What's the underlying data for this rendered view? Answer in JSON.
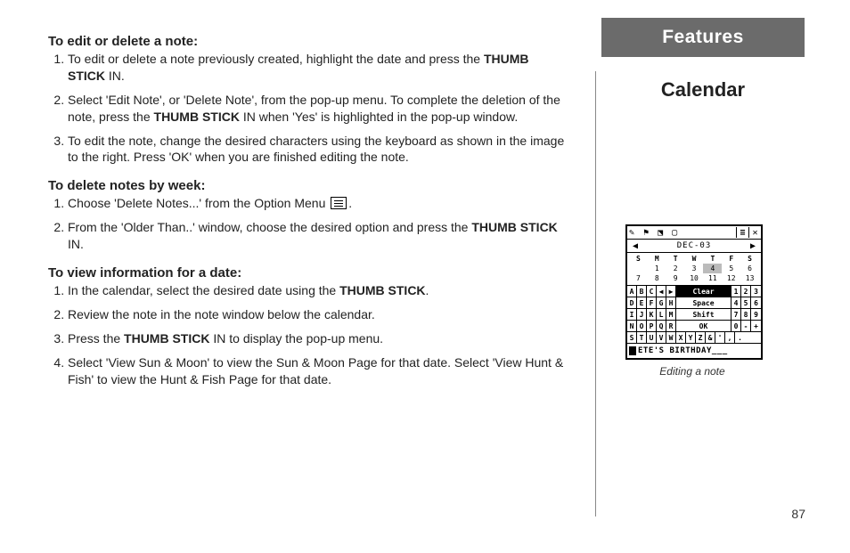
{
  "header": {
    "features": "Features",
    "calendar": "Calendar"
  },
  "sections": {
    "s1": {
      "title": "To edit or delete a note:",
      "li1a": "To edit or delete a note previously created, highlight the date and press the ",
      "li1b": " IN.",
      "li2a": "Select 'Edit Note', or 'Delete Note', from the pop-up menu.  To complete the deletion of the note, press the ",
      "li2b": " IN when 'Yes' is highlighted in the pop-up window.",
      "li3": "To edit the note, change the desired characters using the keyboard as shown in the image to the right.  Press 'OK' when you are finished editing the note."
    },
    "s2": {
      "title": "To delete notes by week:",
      "li1a": "Choose 'Delete Notes...' from the Option Menu ",
      "li1b": ".",
      "li2a": "From the 'Older Than..' window, choose the desired option and press the ",
      "li2b": " IN."
    },
    "s3": {
      "title": "To view information for a date:",
      "li1a": "In the calendar, select the desired date using the ",
      "li1b": ".",
      "li2": "Review the note in the note window below the calendar.",
      "li3a": "Press the ",
      "li3b": " IN to display the pop-up menu.",
      "li4": "Select 'View Sun & Moon' to view the Sun & Moon Page for that date.  Select 'View Hunt & Fish' to view the Hunt & Fish Page for that date."
    }
  },
  "thumbstick": "THUMB STICK",
  "device": {
    "month": "DEC-03",
    "days": [
      "S",
      "M",
      "T",
      "W",
      "T",
      "F",
      "S"
    ],
    "row1": [
      "",
      "1",
      "2",
      "3",
      "4",
      "5",
      "6"
    ],
    "row2": [
      "7",
      "8",
      "9",
      "10",
      "11",
      "12",
      "13"
    ],
    "selected": "4",
    "keyboard": {
      "r1_alpha": [
        "A",
        "B",
        "C",
        "◀",
        "▶"
      ],
      "r1_center": "Clear",
      "r1_num": [
        "1",
        "2",
        "3"
      ],
      "r2_alpha": [
        "D",
        "E",
        "F",
        "G",
        "H"
      ],
      "r2_center": "Space",
      "r2_num": [
        "4",
        "5",
        "6"
      ],
      "r3_alpha": [
        "I",
        "J",
        "K",
        "L",
        "M"
      ],
      "r3_center": "Shift",
      "r3_num": [
        "7",
        "8",
        "9"
      ],
      "r4_alpha": [
        "N",
        "O",
        "P",
        "Q",
        "R"
      ],
      "r4_center": "OK",
      "r4_num": [
        "0",
        "-",
        "+"
      ],
      "r5_alpha": [
        "S",
        "T",
        "U",
        "V",
        "W"
      ],
      "r5_rest": [
        "X",
        "Y",
        "Z",
        "&",
        "'",
        ",",
        "."
      ]
    },
    "note_text": "ETE'S  BIRTHDAY___",
    "caption": "Editing a note"
  },
  "page_number": "87"
}
